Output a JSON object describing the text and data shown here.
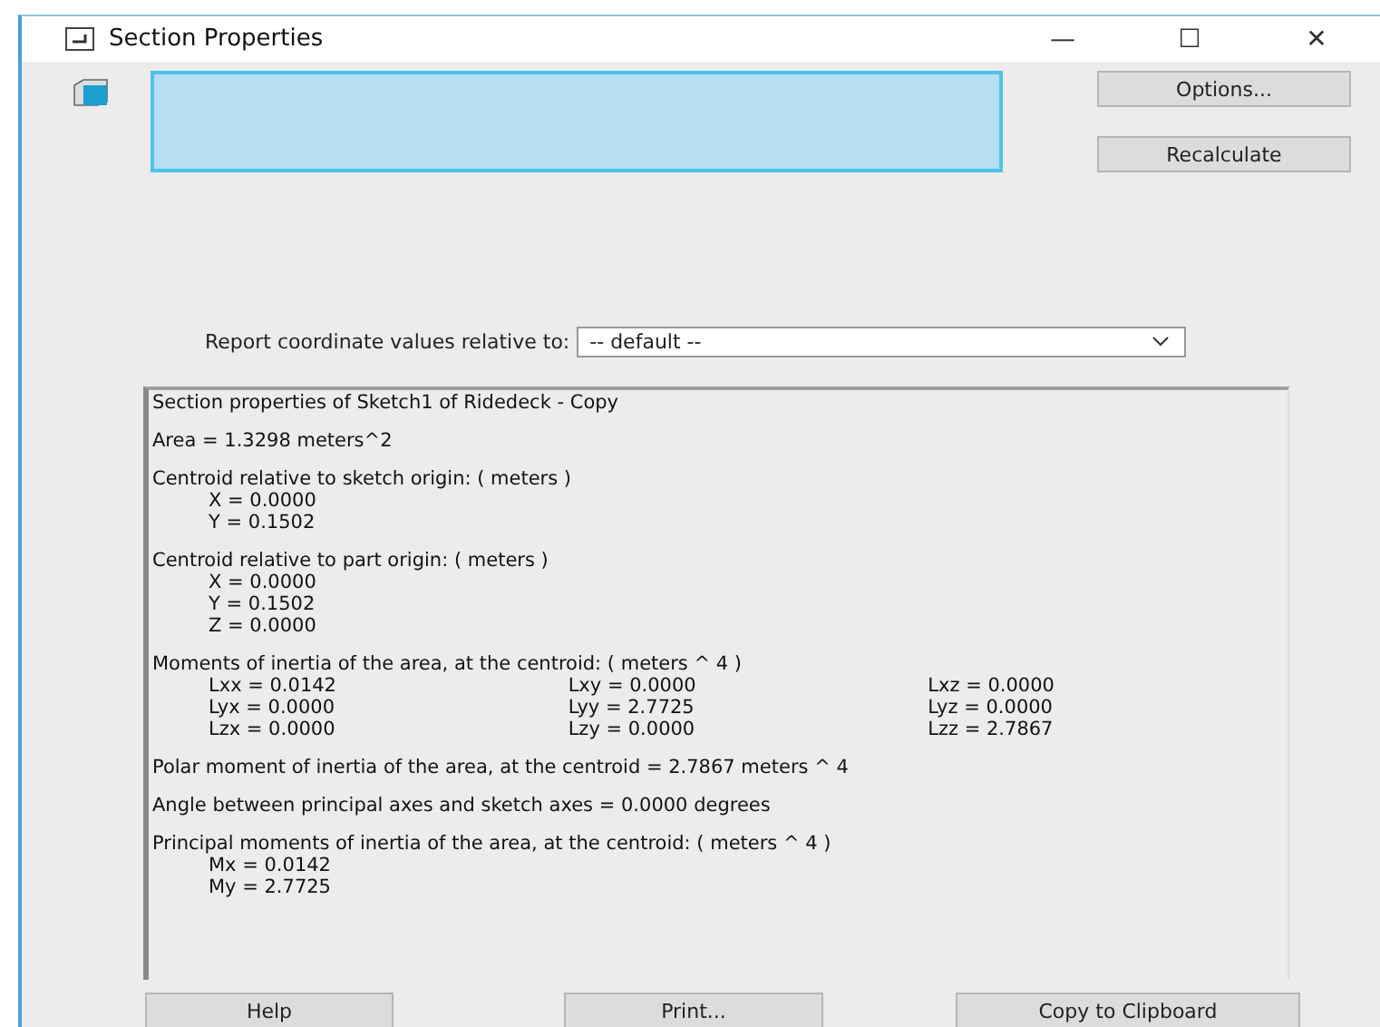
{
  "window": {
    "title": "Section Properties",
    "controls": [
      "—",
      "☐",
      "✕"
    ]
  },
  "buttons_top": [
    "Options...",
    "Recalculate"
  ],
  "report_relative": {
    "label": "Report coordinate values relative to:",
    "value": "-- default --"
  },
  "report": [
    {
      "kind": "line",
      "text": "Section properties of Sketch1 of Ridedeck - Copy"
    },
    {
      "kind": "line",
      "text": "Area = 1.3298 meters^2"
    },
    {
      "kind": "group",
      "heading": "Centroid relative to sketch origin: ( meters )",
      "lines": [
        "X = 0.0000",
        "Y = 0.1502"
      ]
    },
    {
      "kind": "group",
      "heading": "Centroid relative to part origin: ( meters )",
      "lines": [
        "X = 0.0000",
        "Y = 0.1502",
        "Z = 0.0000"
      ]
    },
    {
      "kind": "grid",
      "heading": "Moments of inertia of the area, at the centroid: ( meters ^ 4 )",
      "rows": [
        [
          "Lxx = 0.0142",
          "Lxy = 0.0000",
          "Lxz = 0.0000"
        ],
        [
          "Lyx = 0.0000",
          "Lyy = 2.7725",
          "Lyz = 0.0000"
        ],
        [
          "Lzx = 0.0000",
          "Lzy = 0.0000",
          "Lzz = 2.7867"
        ]
      ]
    },
    {
      "kind": "line",
      "text": "Polar moment of inertia of the area, at the centroid = 2.7867 meters ^ 4"
    },
    {
      "kind": "line",
      "text": "Angle between principal axes and sketch axes = 0.0000 degrees"
    },
    {
      "kind": "group",
      "heading": "Principal moments of inertia of the area, at the centroid: ( meters ^ 4 )",
      "lines": [
        "Mx = 0.0142",
        "My = 2.7725"
      ]
    }
  ],
  "buttons_bottom": [
    "Help",
    "Print...",
    "Copy to Clipboard"
  ]
}
